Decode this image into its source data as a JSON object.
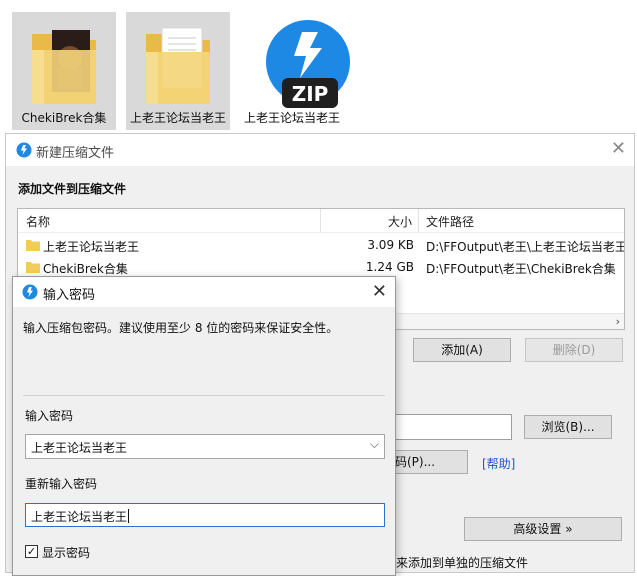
{
  "desktop": {
    "icons": [
      {
        "label": "ChekiBrek合集"
      },
      {
        "label": "上老王论坛当老王"
      },
      {
        "label": "上老王论坛当老王",
        "badge": "ZIP"
      }
    ]
  },
  "main_window": {
    "title": "新建压缩文件",
    "section_heading": "添加文件到压缩文件",
    "columns": {
      "name": "名称",
      "size": "大小",
      "path": "文件路径"
    },
    "files": [
      {
        "name": "上老王论坛当老王",
        "size": "3.09 KB",
        "path": "D:\\FFOutput\\老王\\上老王论坛当老王"
      },
      {
        "name": "ChekiBrek合集",
        "size": "1.24 GB",
        "path": "D:\\FFOutput\\老王\\ChekiBrek合集"
      }
    ],
    "scroll_right_glyph": "›",
    "add_button": "添加(A)",
    "delete_button": "删除(D)",
    "browse_button": "浏览(B)...",
    "password_button_fragment": "码(P)...",
    "help_link": "[帮助]",
    "advanced_button": "高级设置 »",
    "bottom_text_fragment": "来添加到单独的压缩文件",
    "icons": {
      "close": "close-icon",
      "logo": "bandizip-logo-icon",
      "folder": "folder-icon"
    }
  },
  "password_dialog": {
    "title": "输入密码",
    "description": "输入压缩包密码。建议使用至少 8 位的密码来保证安全性。",
    "password_label": "输入密码",
    "password_value": "上老王论坛当老王",
    "confirm_label": "重新输入密码",
    "confirm_value": "上老王论坛当老王",
    "show_password_label": "显示密码",
    "show_password_checked": true,
    "check_glyph": "✓",
    "combo_arrow": "⌵"
  },
  "colors": {
    "accent_blue": "#1e88e5",
    "folder_yellow": "#f2cc5b",
    "link_blue": "#1a57c9",
    "dialog_bg": "#f0f0f0"
  }
}
